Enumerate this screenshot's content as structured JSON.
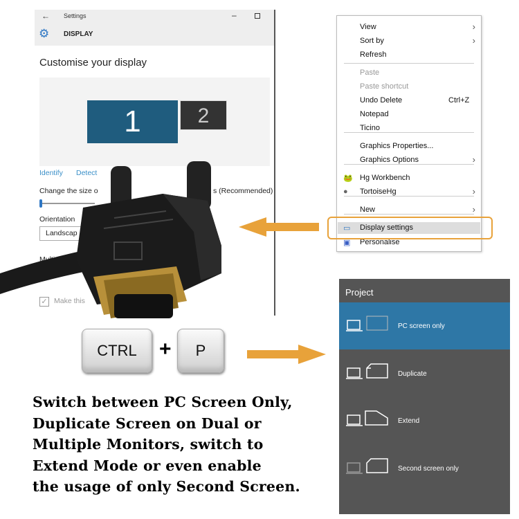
{
  "settings": {
    "window_title": "Settings",
    "section": "DISPLAY",
    "heading": "Customise your display",
    "monitor1": "1",
    "monitor2": "2",
    "identify": "Identify",
    "detect": "Detect",
    "size_label_left": "Change the size o",
    "size_label_right": "s (Recommended)",
    "orientation_label": "Orientation",
    "orientation_value": "Landscap",
    "multi_label": "Multi",
    "make_this_label": "Make this"
  },
  "context_menu": {
    "items": [
      {
        "label": "View",
        "submenu": true
      },
      {
        "label": "Sort by",
        "submenu": true
      },
      {
        "label": "Refresh"
      },
      {
        "label": "Paste",
        "disabled": true
      },
      {
        "label": "Paste shortcut",
        "disabled": true
      },
      {
        "label": "Undo Delete",
        "shortcut": "Ctrl+Z"
      },
      {
        "label": "Notepad"
      },
      {
        "label": "Ticino"
      },
      {
        "label": "Graphics Properties..."
      },
      {
        "label": "Graphics Options",
        "submenu": true
      },
      {
        "label": "Hg Workbench",
        "icon": "hg-workbench-icon"
      },
      {
        "label": "TortoiseHg",
        "submenu": true,
        "icon": "tortoisehg-icon"
      },
      {
        "label": "New",
        "submenu": true
      },
      {
        "label": "Display settings",
        "highlighted": true,
        "icon": "display-icon"
      },
      {
        "label": "Personalise",
        "icon": "personalise-icon"
      }
    ]
  },
  "project": {
    "title": "Project",
    "options": [
      {
        "label": "PC screen only",
        "selected": true
      },
      {
        "label": "Duplicate"
      },
      {
        "label": "Extend"
      },
      {
        "label": "Second screen only"
      }
    ]
  },
  "keys": {
    "ctrl": "CTRL",
    "plus": "+",
    "p": "P"
  },
  "caption": [
    "Switch between PC Screen Only,",
    "Duplicate Screen on Dual or",
    "Multiple Monitors, switch to",
    "Extend Mode or even enable",
    "the usage of only Second Screen."
  ],
  "colors": {
    "accent_orange": "#e8a23a",
    "project_selected": "#2e77a6",
    "monitor1": "#1f5c7e"
  }
}
